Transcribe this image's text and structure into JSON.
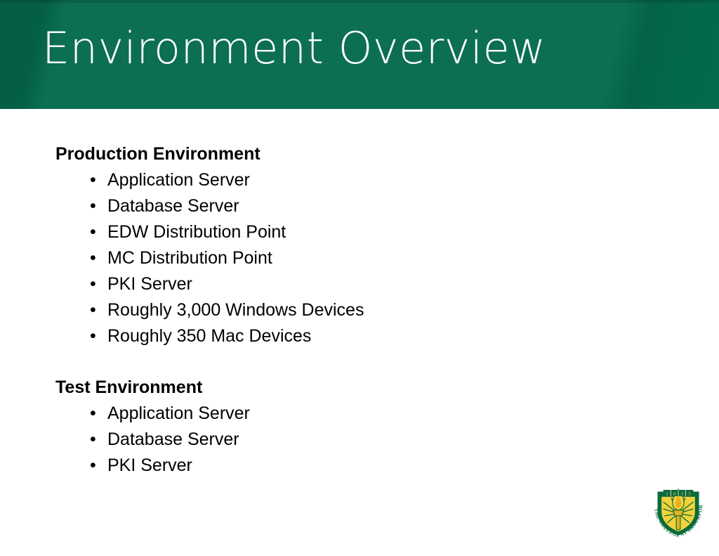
{
  "slide": {
    "title": "Environment Overview",
    "background_color": "#FFFFFF",
    "banner_color": "#046A4C",
    "title_color": "#FFFFFF",
    "text_color": "#000000"
  },
  "content": {
    "groups": [
      {
        "heading": "Production Environment",
        "items": [
          "Application Server",
          "Database Server",
          "EDW Distribution Point",
          "MC Distribution Point",
          "PKI Server",
          "Roughly 3,000 Windows Devices",
          "Roughly 350 Mac Devices"
        ]
      },
      {
        "heading": "Test Environment",
        "items": [
          "Application Server",
          "Database Server",
          "PKI Server"
        ]
      }
    ],
    "bullet_glyph": "•"
  },
  "logo": {
    "name": "college-at-brockport-crest",
    "year": "1835",
    "ring_text_left": "THE COLLEGE",
    "ring_text_right": "AT BROCKPORT",
    "shield_color": "#0B6B3A",
    "sunburst_color": "#F2D23B",
    "torch_color": "#E8B21F",
    "banner_color": "#11683C"
  }
}
